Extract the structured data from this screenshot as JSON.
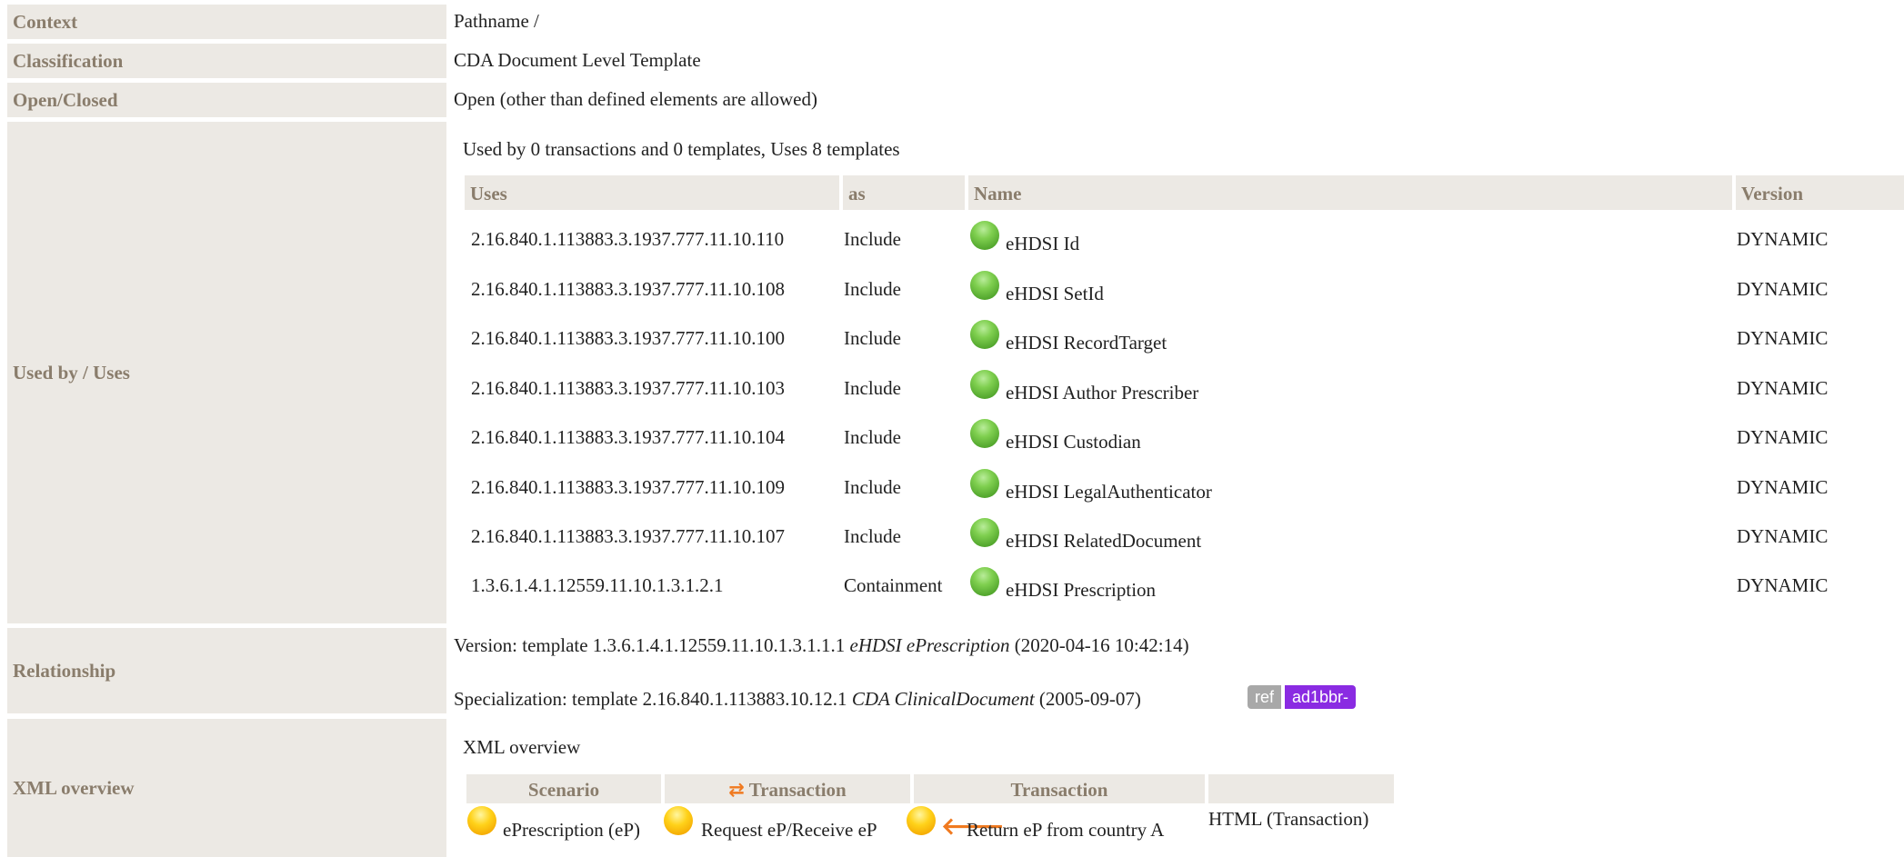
{
  "rows": {
    "context": {
      "label": "Context",
      "value": "Pathname /"
    },
    "classification": {
      "label": "Classification",
      "value": "CDA Document Level Template"
    },
    "open_closed": {
      "label": "Open/Closed",
      "value": "Open (other than defined elements are allowed)"
    },
    "used_by": {
      "label": "Used by / Uses",
      "summary": "Used by 0 transactions and 0 templates, Uses 8 templates",
      "headers": {
        "uses": "Uses",
        "as": "as",
        "name": "Name",
        "version": "Version"
      },
      "items": [
        {
          "uses": "2.16.840.1.113883.3.1937.777.11.10.110",
          "as": "Include",
          "name": "eHDSI Id",
          "version": "DYNAMIC",
          "status_color": "#6cc03c"
        },
        {
          "uses": "2.16.840.1.113883.3.1937.777.11.10.108",
          "as": "Include",
          "name": "eHDSI SetId",
          "version": "DYNAMIC",
          "status_color": "#6cc03c"
        },
        {
          "uses": "2.16.840.1.113883.3.1937.777.11.10.100",
          "as": "Include",
          "name": "eHDSI RecordTarget",
          "version": "DYNAMIC",
          "status_color": "#6cc03c"
        },
        {
          "uses": "2.16.840.1.113883.3.1937.777.11.10.103",
          "as": "Include",
          "name": "eHDSI Author Prescriber",
          "version": "DYNAMIC",
          "status_color": "#6cc03c"
        },
        {
          "uses": "2.16.840.1.113883.3.1937.777.11.10.104",
          "as": "Include",
          "name": "eHDSI Custodian",
          "version": "DYNAMIC",
          "status_color": "#6cc03c"
        },
        {
          "uses": "2.16.840.1.113883.3.1937.777.11.10.109",
          "as": "Include",
          "name": "eHDSI LegalAuthenticator",
          "version": "DYNAMIC",
          "status_color": "#6cc03c"
        },
        {
          "uses": "2.16.840.1.113883.3.1937.777.11.10.107",
          "as": "Include",
          "name": "eHDSI RelatedDocument",
          "version": "DYNAMIC",
          "status_color": "#6cc03c"
        },
        {
          "uses": "1.3.6.1.4.1.12559.11.10.1.3.1.2.1",
          "as": "Containment",
          "name": "eHDSI Prescription",
          "version": "DYNAMIC",
          "status_color": "#6cc03c"
        }
      ]
    },
    "relationship": {
      "label": "Relationship",
      "version_prefix": "Version: template 1.3.6.1.4.1.12559.11.10.1.3.1.1.1",
      "version_name": "eHDSI ePrescription",
      "version_date": "(2020-04-16 10:42:14)",
      "spec_prefix": "Specialization: template 2.16.840.1.113883.10.12.1",
      "spec_name": "CDA ClinicalDocument",
      "spec_date": "(2005-09-07)",
      "badge_ref": "ref",
      "badge_id": "ad1bbr-"
    },
    "xml_overview": {
      "label": "XML overview",
      "caption": "XML overview",
      "headers": {
        "scenario": "Scenario",
        "transaction1": "Transaction",
        "transaction2": "Transaction",
        "empty": ""
      },
      "row": {
        "scenario": "ePrescription (eP)",
        "transaction1": "Request eP/Receive eP",
        "transaction2": "Return eP from country A",
        "link": "HTML (Transaction)"
      }
    }
  },
  "colors": {
    "label_bg": "#ece9e4",
    "label_text": "#8a7d6c",
    "badge_ref": "#a8a8a8",
    "badge_id": "#8a2be2",
    "arrow": "#f07a20"
  }
}
